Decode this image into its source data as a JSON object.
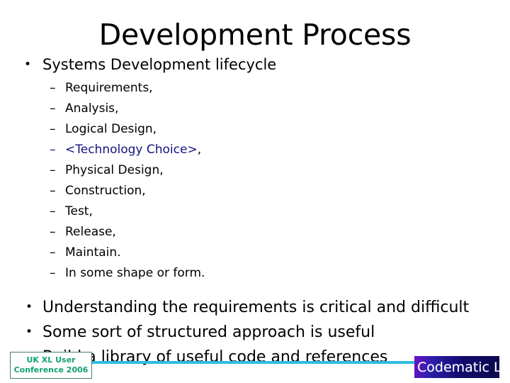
{
  "slide": {
    "title": "Development Process",
    "bullet_marker": "•",
    "dash_marker": "–",
    "sections": [
      {
        "heading": "Systems Development lifecycle",
        "items": [
          {
            "text": "Requirements,",
            "accent": false
          },
          {
            "text": "Analysis,",
            "accent": false
          },
          {
            "text": "Logical Design,",
            "accent": false
          },
          {
            "text": "<Technology Choice>",
            "tail": ",",
            "accent": true
          },
          {
            "text": "Physical Design,",
            "accent": false
          },
          {
            "text": "Construction,",
            "accent": false
          },
          {
            "text": "Test,",
            "accent": false
          },
          {
            "text": "Release,",
            "accent": false
          },
          {
            "text": "Maintain.",
            "accent": false
          },
          {
            "text": "In some shape or form.",
            "accent": false
          }
        ]
      }
    ],
    "closing_points": [
      "Understanding the requirements is critical and difficult",
      "Some sort of structured approach is useful",
      "Build a library of useful code and references"
    ]
  },
  "footer": {
    "conference": {
      "line1": "UK XL User",
      "line2": "Conference 2006",
      "text_color": "#0fa36c",
      "border_color": "#4c7d64"
    },
    "rule_color": "#2fbde0",
    "logo": {
      "text": "Codematic Ltd.",
      "text_color": "#ffffff",
      "background_from": "#6a12c6",
      "background_to": "#0d0a4a"
    }
  },
  "colors": {
    "background": "#ffffff",
    "body_text": "#000000",
    "accent_text": "#13137f"
  }
}
